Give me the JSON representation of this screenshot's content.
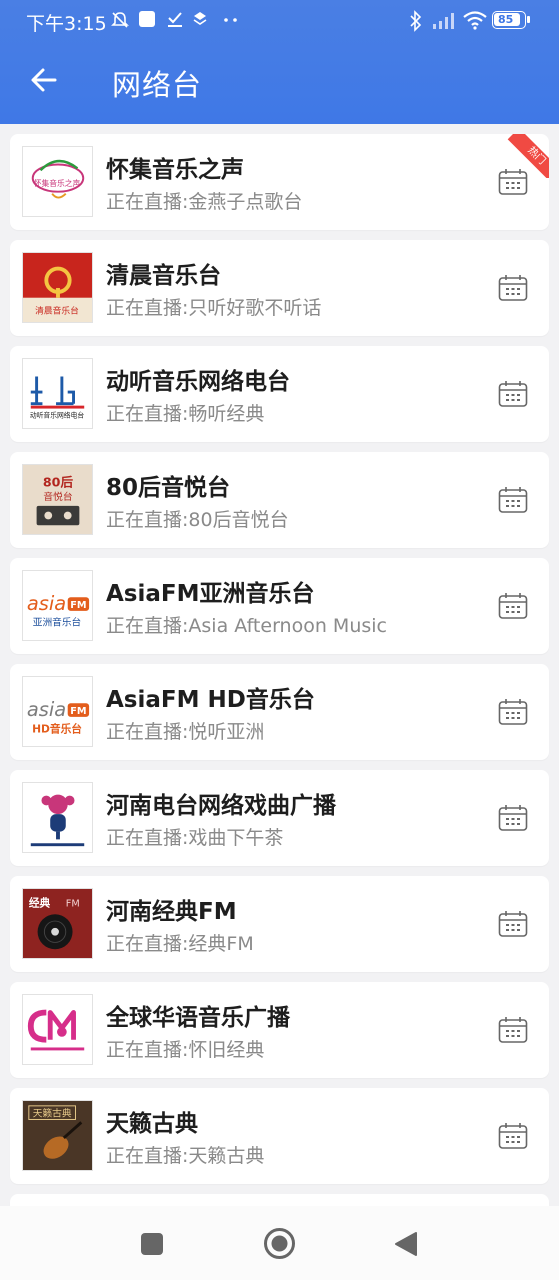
{
  "status_bar": {
    "time": "下午3:15",
    "battery": "85"
  },
  "header": {
    "title": "网络台"
  },
  "hot_badge": "热门",
  "stations": [
    {
      "name": "怀集音乐之声",
      "now_playing": "正在直播:金燕子点歌台",
      "hot": true,
      "logo": "huaiji-logo"
    },
    {
      "name": "清晨音乐台",
      "now_playing": "正在直播:只听好歌不听话",
      "hot": false,
      "logo": "qingchen-logo"
    },
    {
      "name": "动听音乐网络电台",
      "now_playing": "正在直播:畅听经典",
      "hot": false,
      "logo": "dongting-logo"
    },
    {
      "name": "80后音悦台",
      "now_playing": "正在直播:80后音悦台",
      "hot": false,
      "logo": "80hou-logo"
    },
    {
      "name": "AsiaFM亚洲音乐台",
      "now_playing": "正在直播:Asia Afternoon Music",
      "hot": false,
      "logo": "asiafm-logo"
    },
    {
      "name": "AsiaFM HD音乐台",
      "now_playing": "正在直播:悦听亚洲",
      "hot": false,
      "logo": "asiafm-hd-logo"
    },
    {
      "name": "河南电台网络戏曲广播",
      "now_playing": "正在直播:戏曲下午茶",
      "hot": false,
      "logo": "henan-xiqu-logo"
    },
    {
      "name": "河南经典FM",
      "now_playing": "正在直播:经典FM",
      "hot": false,
      "logo": "henan-jingdian-logo"
    },
    {
      "name": "全球华语音乐广播",
      "now_playing": "正在直播:怀旧经典",
      "hot": false,
      "logo": "quanqiu-huayu-logo"
    },
    {
      "name": "天籁古典",
      "now_playing": "正在直播:天籁古典",
      "hot": false,
      "logo": "tianlai-logo"
    }
  ],
  "logo_text": {
    "huaiji": "怀集音乐之声",
    "qingchen": "清晨音乐台",
    "dongting": "动听音乐网络电台",
    "eighties_top": "80后",
    "eighties_bottom": "音悦台",
    "asia": "asia",
    "fm": "FM",
    "asia_cn": "亚洲音乐台",
    "hd_cn": "HD音乐台",
    "jingdian": "经典",
    "tianlai": "天籁古典"
  },
  "colors": {
    "header": "#3f78e6",
    "hot": "#f04a43",
    "title": "#1e1e1e",
    "subtitle": "#8a8a8a"
  }
}
